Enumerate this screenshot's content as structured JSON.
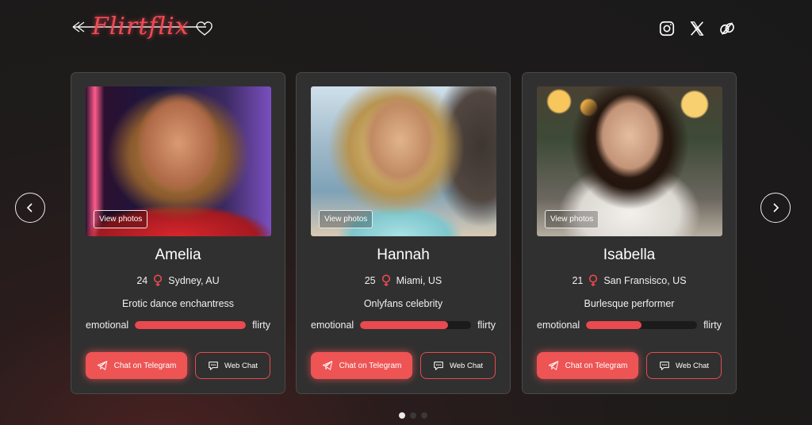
{
  "brand": {
    "name": "Flirtflix",
    "accent": "#e84a4f"
  },
  "socials": [
    {
      "icon": "instagram-icon"
    },
    {
      "icon": "x-icon"
    },
    {
      "icon": "leaf-icon"
    }
  ],
  "cards": [
    {
      "name": "Amelia",
      "age": "24",
      "location": "Sydney, AU",
      "role": "Erotic dance enchantress",
      "view_label": "View photos",
      "left_label": "emotional",
      "right_label": "flirty",
      "level": 1.0,
      "tg_label": "Chat on Telegram",
      "web_label": "Web Chat"
    },
    {
      "name": "Hannah",
      "age": "25",
      "location": "Miami, US",
      "role": "Onlyfans celebrity",
      "view_label": "View photos",
      "left_label": "emotional",
      "right_label": "flirty",
      "level": 0.79,
      "tg_label": "Chat on Telegram",
      "web_label": "Web Chat"
    },
    {
      "name": "Isabella",
      "age": "21",
      "location": "San Fransisco, US",
      "role": "Burlesque performer",
      "view_label": "View photos",
      "left_label": "emotional",
      "right_label": "flirty",
      "level": 0.5,
      "tg_label": "Chat on Telegram",
      "web_label": "Web Chat"
    }
  ],
  "pagination": {
    "count": 3,
    "active": 0
  }
}
